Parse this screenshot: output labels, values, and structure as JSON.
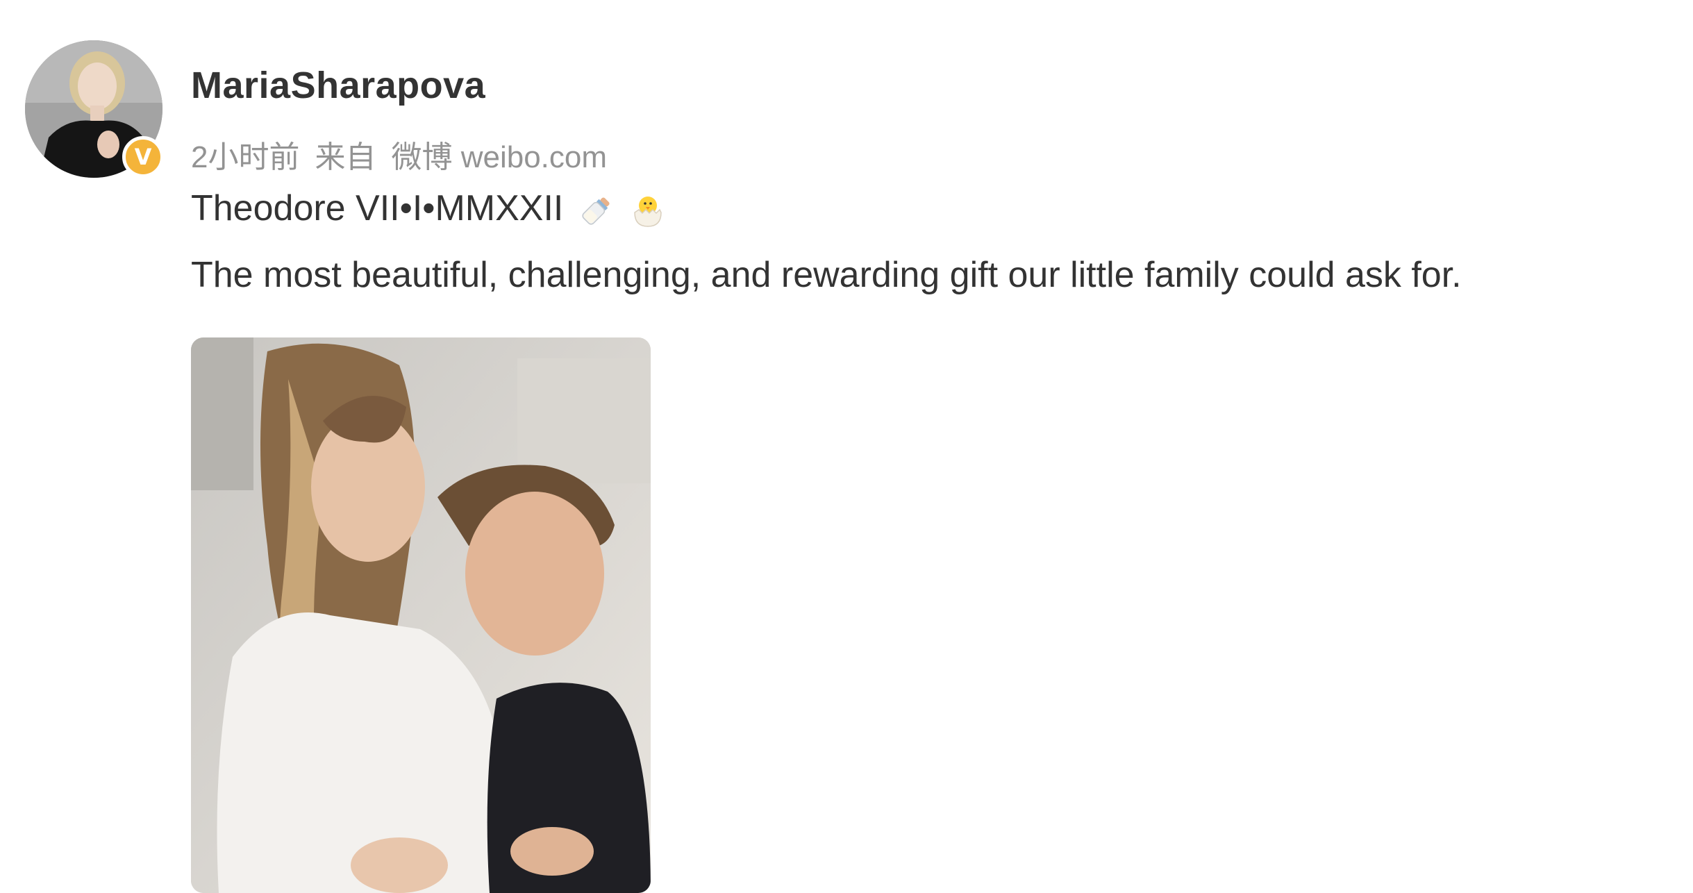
{
  "post": {
    "author": {
      "username": "MariaSharapova",
      "avatar_icon": "avatar-photo",
      "verified_badge": "V",
      "verified_color": "#f4b43a"
    },
    "meta": {
      "time": "2小时前",
      "source_prefix": "来自",
      "source_name": "微博 weibo.com"
    },
    "content": {
      "line1": "Theodore VII•I•MMXXII",
      "line1_emojis": [
        "baby-bottle-icon",
        "hatching-chick-icon"
      ],
      "line2": "The most beautiful, challenging, and rewarding gift our little family could ask for."
    },
    "image": {
      "icon": "family-photo"
    },
    "colors": {
      "text": "#333333",
      "meta": "#939393",
      "background": "#ffffff"
    }
  }
}
